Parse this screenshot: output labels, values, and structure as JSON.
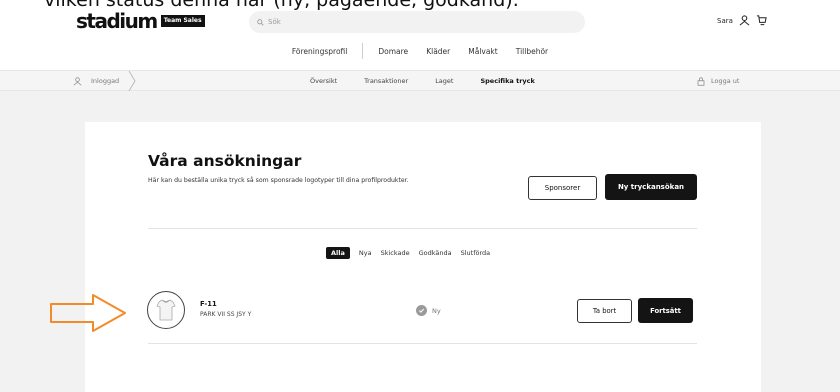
{
  "caption": "vilken status denna har (ny, pågående, godkänd).",
  "header": {
    "logo_text": "stadium",
    "logo_badge": "Team Sales",
    "search_placeholder": "Sök",
    "user_name": "Sara"
  },
  "main_nav": [
    "Föreningsprofil",
    "Domare",
    "Kläder",
    "Målvakt",
    "Tillbehör"
  ],
  "sub_nav": {
    "logged_in": "Inloggad",
    "links": [
      "Översikt",
      "Transaktioner",
      "Laget",
      "Specifika tryck"
    ],
    "active_index": 3,
    "logout": "Logga ut"
  },
  "page": {
    "title": "Våra ansökningar",
    "subtitle": "Här kan du beställa unika tryck så som sponsrade logotyper till dina profilprodukter.",
    "sponsor_button": "Sponsorer",
    "new_request_button": "Ny tryckansökan"
  },
  "filters": {
    "items": [
      "Alla",
      "Nya",
      "Skickade",
      "Godkända",
      "Slutförda"
    ],
    "active_index": 0
  },
  "applications": [
    {
      "code": "F-11",
      "product": "PARK VII SS JSY Y",
      "status": "Ny",
      "remove_label": "Ta bort",
      "continue_label": "Fortsätt"
    }
  ],
  "colors": {
    "accent_dark": "#141414",
    "arrow": "#f28c28",
    "background": "#f2f2f2"
  }
}
